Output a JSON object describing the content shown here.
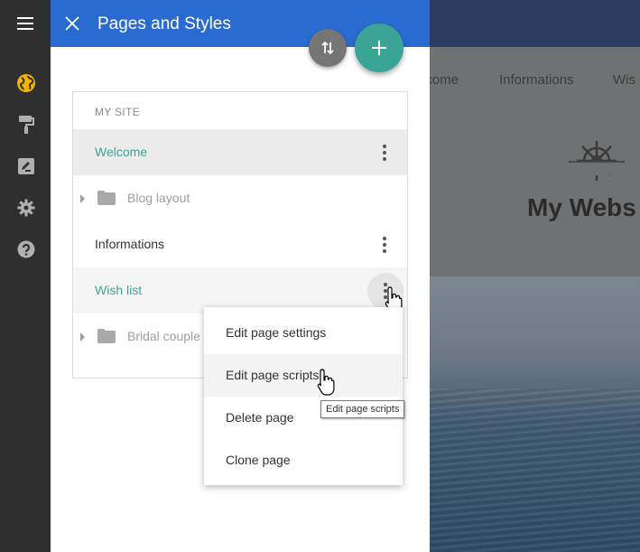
{
  "colors": {
    "panel_header": "#2a6bd1",
    "accent_teal": "#3aa595",
    "rail_background": "#2f2f2f",
    "globe_icon_active": "#f0b400"
  },
  "rail": {
    "items": [
      {
        "icon": "globe-icon"
      },
      {
        "icon": "paint-roller-icon"
      },
      {
        "icon": "edit-icon"
      },
      {
        "icon": "gear-icon"
      },
      {
        "icon": "help-icon"
      }
    ]
  },
  "panel": {
    "title": "Pages and Styles",
    "section_heading": "MY SITE",
    "pages": [
      {
        "label": "Welcome",
        "type": "page",
        "state": "selected"
      },
      {
        "label": "Blog layout",
        "type": "folder"
      },
      {
        "label": "Informations",
        "type": "page"
      },
      {
        "label": "Wish list",
        "type": "page",
        "state": "menu-open"
      },
      {
        "label": "Bridal couple",
        "type": "folder"
      }
    ]
  },
  "context_menu": {
    "items": [
      "Edit page settings",
      "Edit page scripts",
      "Delete page",
      "Clone page"
    ],
    "hovered": "Edit page scripts"
  },
  "tooltip": "Edit page scripts",
  "preview": {
    "nav": [
      "lcome",
      "Informations",
      "Wis"
    ],
    "site_title": "My Webs"
  }
}
